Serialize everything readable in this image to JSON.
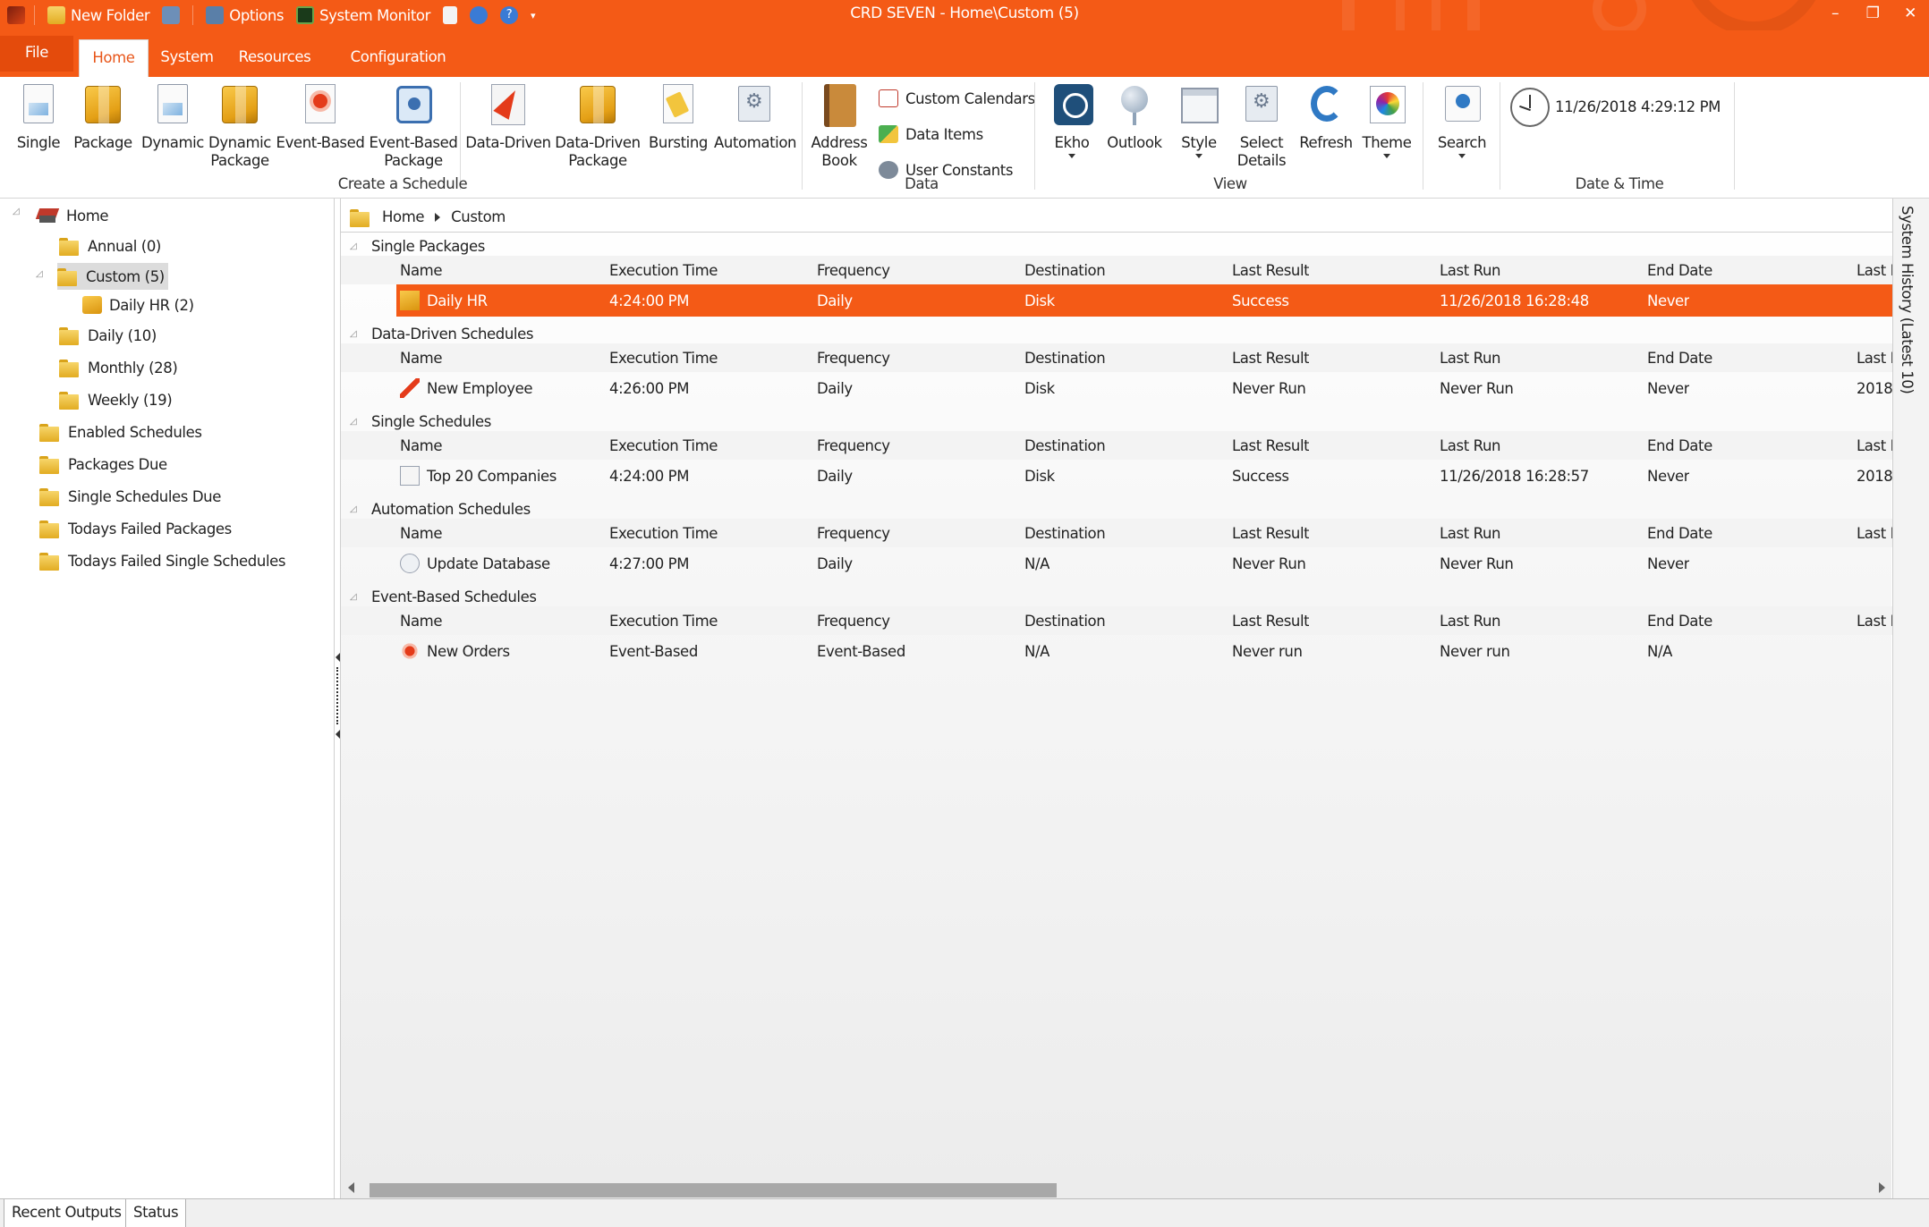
{
  "window": {
    "title": "CRD SEVEN - Home\\Custom (5)",
    "quick_access": [
      "New Folder",
      "Options",
      "System Monitor"
    ]
  },
  "ribbon_tabs": [
    "File",
    "Home",
    "System",
    "Resources",
    "Configuration"
  ],
  "ribbon": {
    "create_group_label": "Create a Schedule",
    "buttons": {
      "single": "Single",
      "package": "Package",
      "dynamic": "Dynamic",
      "dynamic_package": [
        "Dynamic",
        "Package"
      ],
      "event_based": "Event-Based",
      "event_based_package": [
        "Event-Based",
        "Package"
      ],
      "data_driven": "Data-Driven",
      "data_driven_package": [
        "Data-Driven",
        "Package"
      ],
      "bursting": "Bursting",
      "automation": "Automation"
    },
    "data_group": {
      "label": "Data",
      "address_book": [
        "Address",
        "Book"
      ],
      "custom_calendars": "Custom Calendars",
      "data_items": "Data Items",
      "user_constants": "User Constants"
    },
    "view_group": {
      "label": "View",
      "ekho": "Ekho",
      "outlook": "Outlook",
      "style": "Style",
      "select_details": [
        "Select",
        "Details"
      ],
      "refresh": "Refresh",
      "theme": "Theme"
    },
    "search_label": "Search",
    "datetime": {
      "label": "Date & Time",
      "value": "11/26/2018 4:29:12 PM"
    }
  },
  "tree": {
    "root": "Home",
    "folders": [
      "Annual (0)",
      "Custom (5)",
      "Daily HR  (2)",
      "Daily (10)",
      "Monthly (28)",
      "Weekly (19)"
    ],
    "smart_folders": [
      "Enabled Schedules",
      "Packages Due",
      "Single Schedules Due",
      "Todays Failed Packages",
      "Todays Failed Single Schedules"
    ]
  },
  "breadcrumb": [
    "Home",
    "Custom"
  ],
  "columns": [
    "Name",
    "Execution Time",
    "Frequency",
    "Destination",
    "Last Result",
    "Last Run",
    "End Date",
    "Last I"
  ],
  "groups": [
    {
      "title": "Single Packages",
      "rows": [
        {
          "name": "Daily HR",
          "exec": "4:24:00 PM",
          "freq": "Daily",
          "dest": "Disk",
          "result": "Success",
          "lastrun": "11/26/2018 16:28:48",
          "end": "Never",
          "last": ""
        }
      ]
    },
    {
      "title": "Data-Driven Schedules",
      "rows": [
        {
          "name": "New Employee",
          "exec": "4:26:00 PM",
          "freq": "Daily",
          "dest": "Disk",
          "result": "Never Run",
          "lastrun": "Never Run",
          "end": "Never",
          "last": "2018-"
        }
      ]
    },
    {
      "title": "Single Schedules",
      "rows": [
        {
          "name": "Top 20 Companies",
          "exec": "4:24:00 PM",
          "freq": "Daily",
          "dest": "Disk",
          "result": "Success",
          "lastrun": "11/26/2018 16:28:57",
          "end": "Never",
          "last": "2018-"
        }
      ]
    },
    {
      "title": "Automation Schedules",
      "rows": [
        {
          "name": "Update Database",
          "exec": "4:27:00 PM",
          "freq": "Daily",
          "dest": "N/A",
          "result": "Never Run",
          "lastrun": "Never Run",
          "end": "Never",
          "last": ""
        }
      ]
    },
    {
      "title": "Event-Based Schedules",
      "rows": [
        {
          "name": "New Orders",
          "exec": "Event-Based",
          "freq": "Event-Based",
          "dest": "N/A",
          "result": "Never run",
          "lastrun": "Never run",
          "end": "N/A",
          "last": ""
        }
      ]
    }
  ],
  "side_panel": "System History (Latest 10)",
  "bottom_tabs": [
    "Recent Outputs",
    "Status"
  ],
  "colors": {
    "accent": "#f45a16",
    "selected_row": "#f45a16"
  }
}
